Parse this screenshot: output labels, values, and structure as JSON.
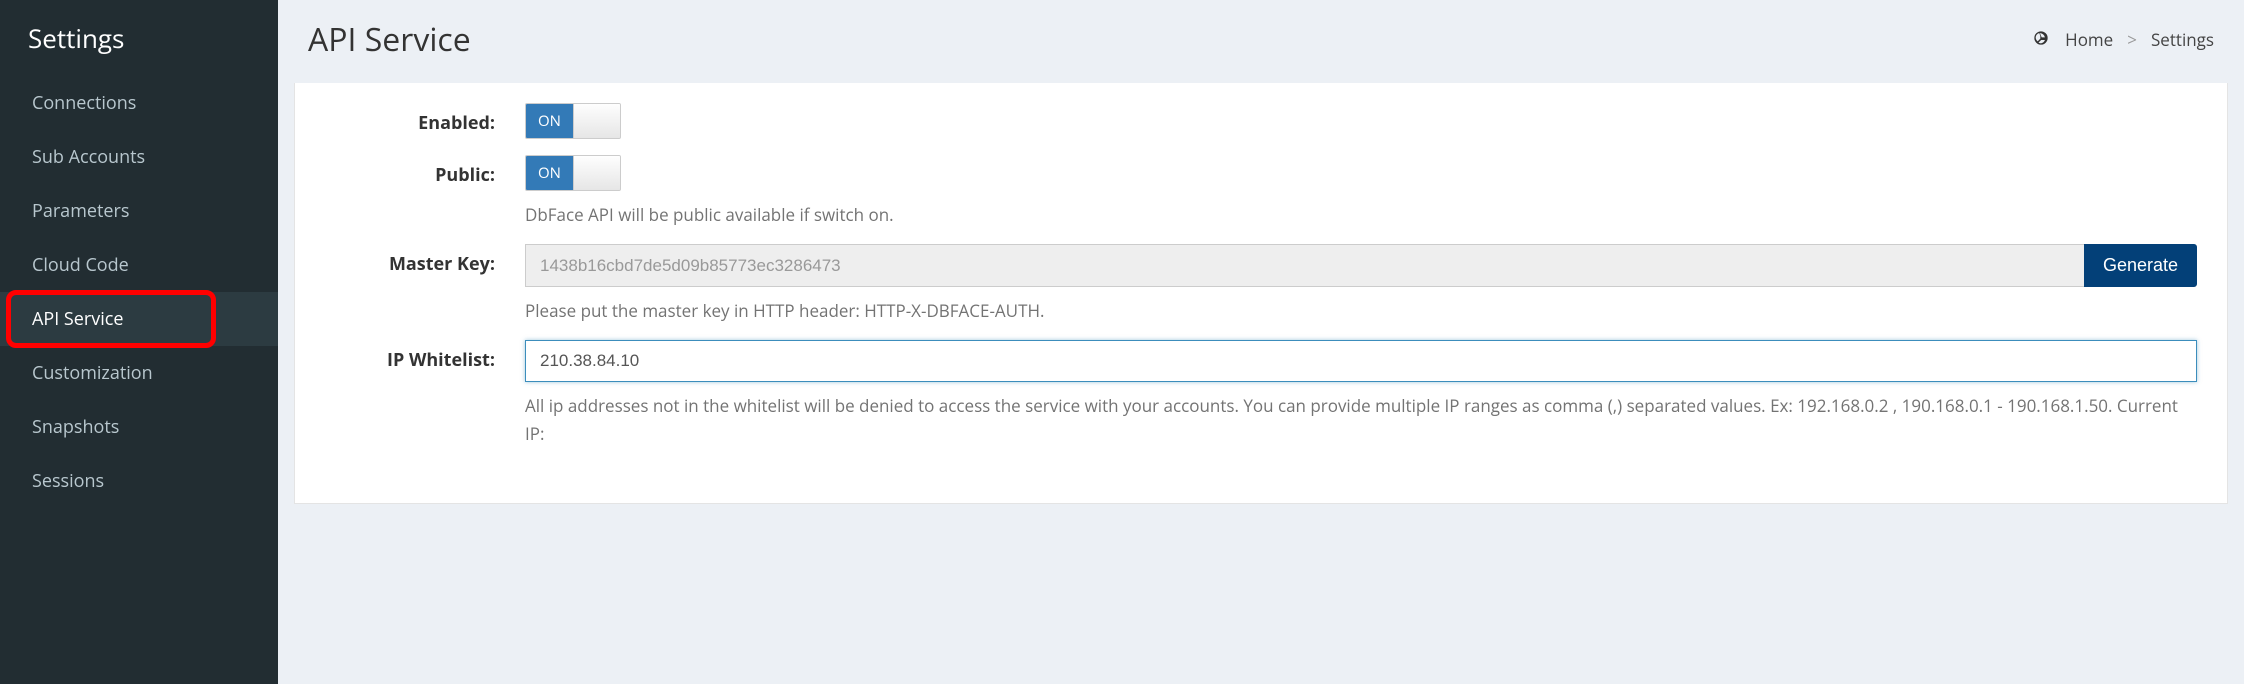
{
  "sidebar": {
    "title": "Settings",
    "items": [
      {
        "label": "Connections",
        "active": false
      },
      {
        "label": "Sub Accounts",
        "active": false
      },
      {
        "label": "Parameters",
        "active": false
      },
      {
        "label": "Cloud Code",
        "active": false
      },
      {
        "label": "API Service",
        "active": true
      },
      {
        "label": "Customization",
        "active": false
      },
      {
        "label": "Snapshots",
        "active": false
      },
      {
        "label": "Sessions",
        "active": false
      }
    ]
  },
  "header": {
    "title": "API Service",
    "breadcrumb": {
      "home": "Home",
      "sep": ">",
      "current": "Settings"
    }
  },
  "form": {
    "enabled": {
      "label": "Enabled:",
      "toggle_text": "ON"
    },
    "public": {
      "label": "Public:",
      "toggle_text": "ON",
      "help": "DbFace API will be public available if switch on."
    },
    "master_key": {
      "label": "Master Key:",
      "value": "1438b16cbd7de5d09b85773ec3286473",
      "button": "Generate",
      "help": "Please put the master key in HTTP header: HTTP-X-DBFACE-AUTH."
    },
    "ip_whitelist": {
      "label": "IP Whitelist:",
      "value": "210.38.84.10",
      "help": "All ip addresses not in the whitelist will be denied to access the service with your accounts. You can provide multiple IP ranges as comma (,) separated values. Ex: 192.168.0.2 , 190.168.0.1 - 190.168.1.50. Current IP:"
    }
  }
}
